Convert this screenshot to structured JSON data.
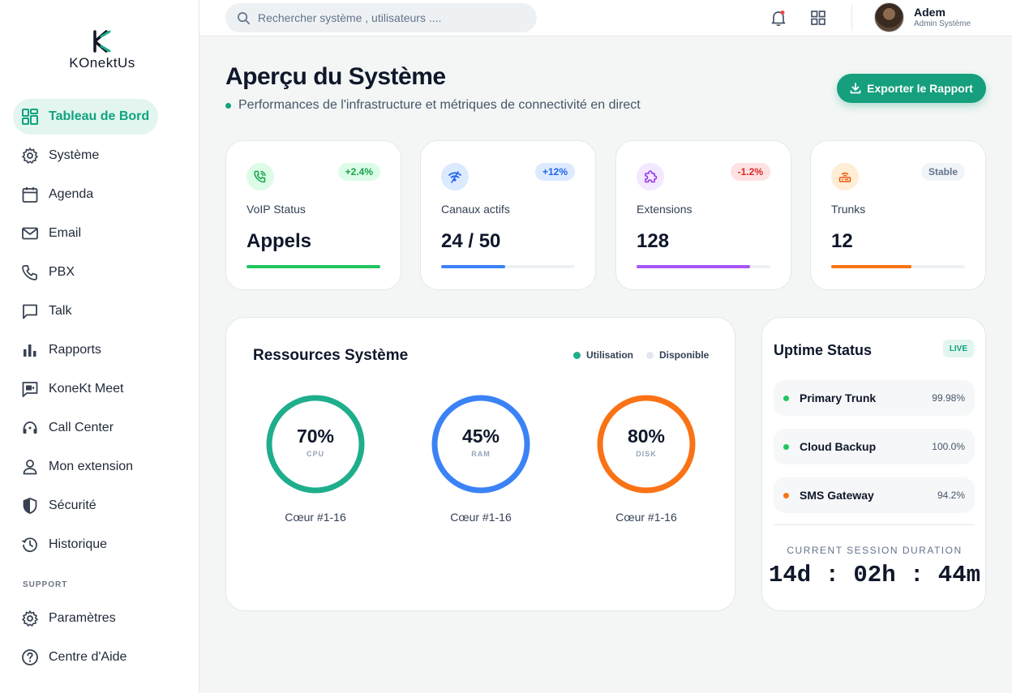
{
  "brand": {
    "name": "KOnektUs"
  },
  "sidebar": {
    "items": [
      {
        "label": "Tableau de Bord",
        "icon": "dashboard-icon"
      },
      {
        "label": "Système",
        "icon": "gear-icon"
      },
      {
        "label": "Agenda",
        "icon": "calendar-icon"
      },
      {
        "label": "Email",
        "icon": "mail-icon"
      },
      {
        "label": "PBX",
        "icon": "phone-icon"
      },
      {
        "label": "Talk",
        "icon": "chat-icon"
      },
      {
        "label": "Rapports",
        "icon": "bar-chart-icon"
      },
      {
        "label": "KoneKt Meet",
        "icon": "video-chat-icon"
      },
      {
        "label": "Call Center",
        "icon": "headset-icon"
      },
      {
        "label": "Mon extension",
        "icon": "user-icon"
      },
      {
        "label": "Sécurité",
        "icon": "shield-icon"
      },
      {
        "label": "Historique",
        "icon": "history-icon"
      }
    ],
    "support_label": "SUPPORT",
    "support_items": [
      {
        "label": "Paramètres",
        "icon": "gear-icon"
      },
      {
        "label": "Centre d'Aide",
        "icon": "help-icon"
      }
    ]
  },
  "topbar": {
    "search_placeholder": "Rechercher système , utilisateurs ....",
    "user": {
      "name": "Adem",
      "role": "Admin Système"
    }
  },
  "header": {
    "title": "Aperçu du Système",
    "subtitle": "Performances de l'infrastructure et métriques de connectivité en direct",
    "export_label": "Exporter le Rapport"
  },
  "stats": [
    {
      "label": "VoIP Status",
      "value": "Appels",
      "badge": "+2.4%",
      "icon": "phone-wifi-icon",
      "color": "#22c55e",
      "progress": 1.0
    },
    {
      "label": "Canaux actifs",
      "value": "24 / 50",
      "badge": "+12%",
      "icon": "wifi-signal-icon",
      "color": "#3b82f6",
      "progress": 0.48
    },
    {
      "label": "Extensions",
      "value": "128",
      "badge": "-1.2%",
      "icon": "puzzle-icon",
      "color": "#a855f7",
      "progress": 0.85
    },
    {
      "label": "Trunks",
      "value": "12",
      "badge": "Stable",
      "icon": "router-icon",
      "color": "#f97316",
      "progress": 0.6
    }
  ],
  "resources": {
    "title": "Ressources Système",
    "legend": {
      "used": "Utilisation",
      "free": "Disponible"
    },
    "gauges": [
      {
        "value": "70%",
        "label": "CPU",
        "caption": "Cœur #1-16",
        "percent": 70,
        "color": "#1fae8c"
      },
      {
        "value": "45%",
        "label": "RAM",
        "caption": "Cœur #1-16",
        "percent": 45,
        "color": "#3b82f6"
      },
      {
        "value": "80%",
        "label": "DISK",
        "caption": "Cœur #1-16",
        "percent": 80,
        "color": "#f97316"
      }
    ]
  },
  "uptime": {
    "title": "Uptime Status",
    "badge": "LIVE",
    "rows": [
      {
        "name": "Primary Trunk",
        "percent": "99.98%",
        "color": "#22c55e"
      },
      {
        "name": "Cloud Backup",
        "percent": "100.0%",
        "color": "#22c55e"
      },
      {
        "name": "SMS Gateway",
        "percent": "94.2%",
        "color": "#f97316"
      }
    ],
    "session_label": "CURRENT SESSION DURATION",
    "session_value": "14d : 02h : 44m"
  }
}
